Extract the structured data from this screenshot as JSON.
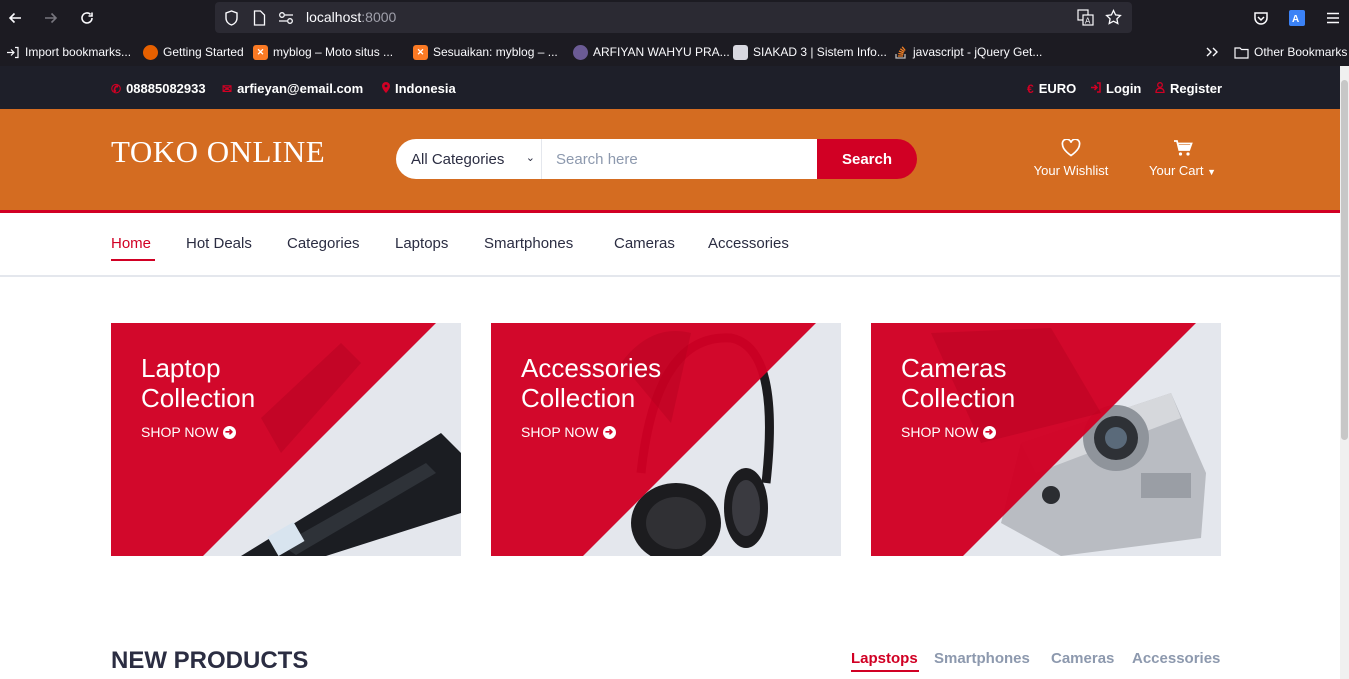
{
  "browser": {
    "url_host": "localhost",
    "url_port": ":8000",
    "bookmarks": [
      {
        "label": "Import bookmarks...",
        "icon": "import-icon"
      },
      {
        "label": "Getting Started",
        "icon": "firefox-icon"
      },
      {
        "label": "myblog – Moto situs ...",
        "icon": "xampp-icon"
      },
      {
        "label": "Sesuaikan: myblog – ...",
        "icon": "xampp-icon"
      },
      {
        "label": "ARFIYAN WAHYU PRA...",
        "icon": "university-icon"
      },
      {
        "label": "SIAKAD 3 | Sistem Info...",
        "icon": "siakad-icon"
      },
      {
        "label": "javascript - jQuery Get...",
        "icon": "stackoverflow-icon"
      }
    ],
    "other_bookmarks": "Other Bookmarks"
  },
  "topbar": {
    "phone": "08885082933",
    "email": "arfieyan@email.com",
    "location": "Indonesia",
    "currency": "EURO",
    "login": "Login",
    "register": "Register"
  },
  "header": {
    "logo": "TOKO ONLINE",
    "category_selected": "All Categories",
    "search_placeholder": "Search here",
    "search_button": "Search",
    "wishlist": "Your Wishlist",
    "cart": "Your Cart"
  },
  "menu": [
    "Home",
    "Hot Deals",
    "Categories",
    "Laptops",
    "Smartphones",
    "Cameras",
    "Accessories"
  ],
  "collections": [
    {
      "line1": "Laptop",
      "line2": "Collection",
      "cta": "SHOP NOW"
    },
    {
      "line1": "Accessories",
      "line2": "Collection",
      "cta": "SHOP NOW"
    },
    {
      "line1": "Cameras",
      "line2": "Collection",
      "cta": "SHOP NOW"
    }
  ],
  "new_products": {
    "title": "NEW PRODUCTS",
    "tabs": [
      "Lapstops",
      "Smartphones",
      "Cameras",
      "Accessories"
    ]
  },
  "colors": {
    "accent": "#d10024",
    "header_bg": "#d46c21",
    "topbar_bg": "#1e1f29",
    "text_dark": "#2b2d42",
    "text_muted": "#8d99ae"
  }
}
